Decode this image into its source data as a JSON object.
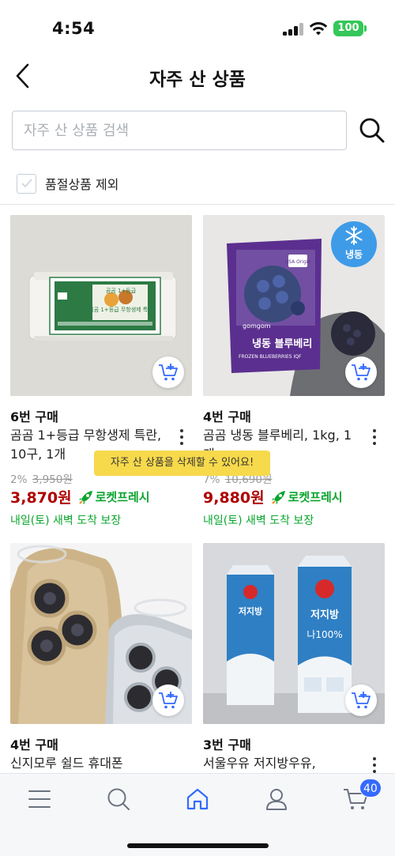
{
  "status_bar": {
    "time": "4:54",
    "battery": "100"
  },
  "header": {
    "title": "자주 산 상품"
  },
  "search": {
    "placeholder": "자주 산 상품 검색",
    "value": ""
  },
  "filter": {
    "label": "품절상품 제외",
    "checked": false
  },
  "products": [
    {
      "purchase_count": "6번 구매",
      "name": "곰곰 1+등급 무항생제 특란, 10구, 1개",
      "discount": "2%",
      "original_price": "3,950원",
      "price": "3,870원",
      "badge": "로켓프레시",
      "delivery": "내일(토) 새벽 도착 보장",
      "image_caption": "곰곰 1+등급 무항생제 특란"
    },
    {
      "purchase_count": "4번 구매",
      "name": "곰곰 냉동 블루베리, 1kg, 1개",
      "discount": "7%",
      "original_price": "10,690원",
      "price": "9,880원",
      "badge": "로켓프레시",
      "delivery": "내일(토) 새벽 도착 보장",
      "frozen_tag": "냉동",
      "image_caption": "냉동 블루베리",
      "image_subcaption": "FROZEN BLUEBERRIES IQF",
      "image_brand": "gomgom",
      "image_origin": "USA Origin"
    },
    {
      "purchase_count": "4번 구매",
      "name": "신지모루 쉴드 휴대폰"
    },
    {
      "purchase_count": "3번 구매",
      "name": "서울우유 저지방우유,",
      "image_caption": "저지방",
      "image_subcaption": "나100%"
    }
  ],
  "toast": "자주 산 상품을 삭제할 수 있어요!",
  "tab_bar": {
    "cart_count": "40"
  },
  "colors": {
    "price": "#ae0000",
    "rocket_green": "#0aa52e",
    "accent_blue": "#346aff",
    "toast_yellow": "#f7d94c"
  }
}
